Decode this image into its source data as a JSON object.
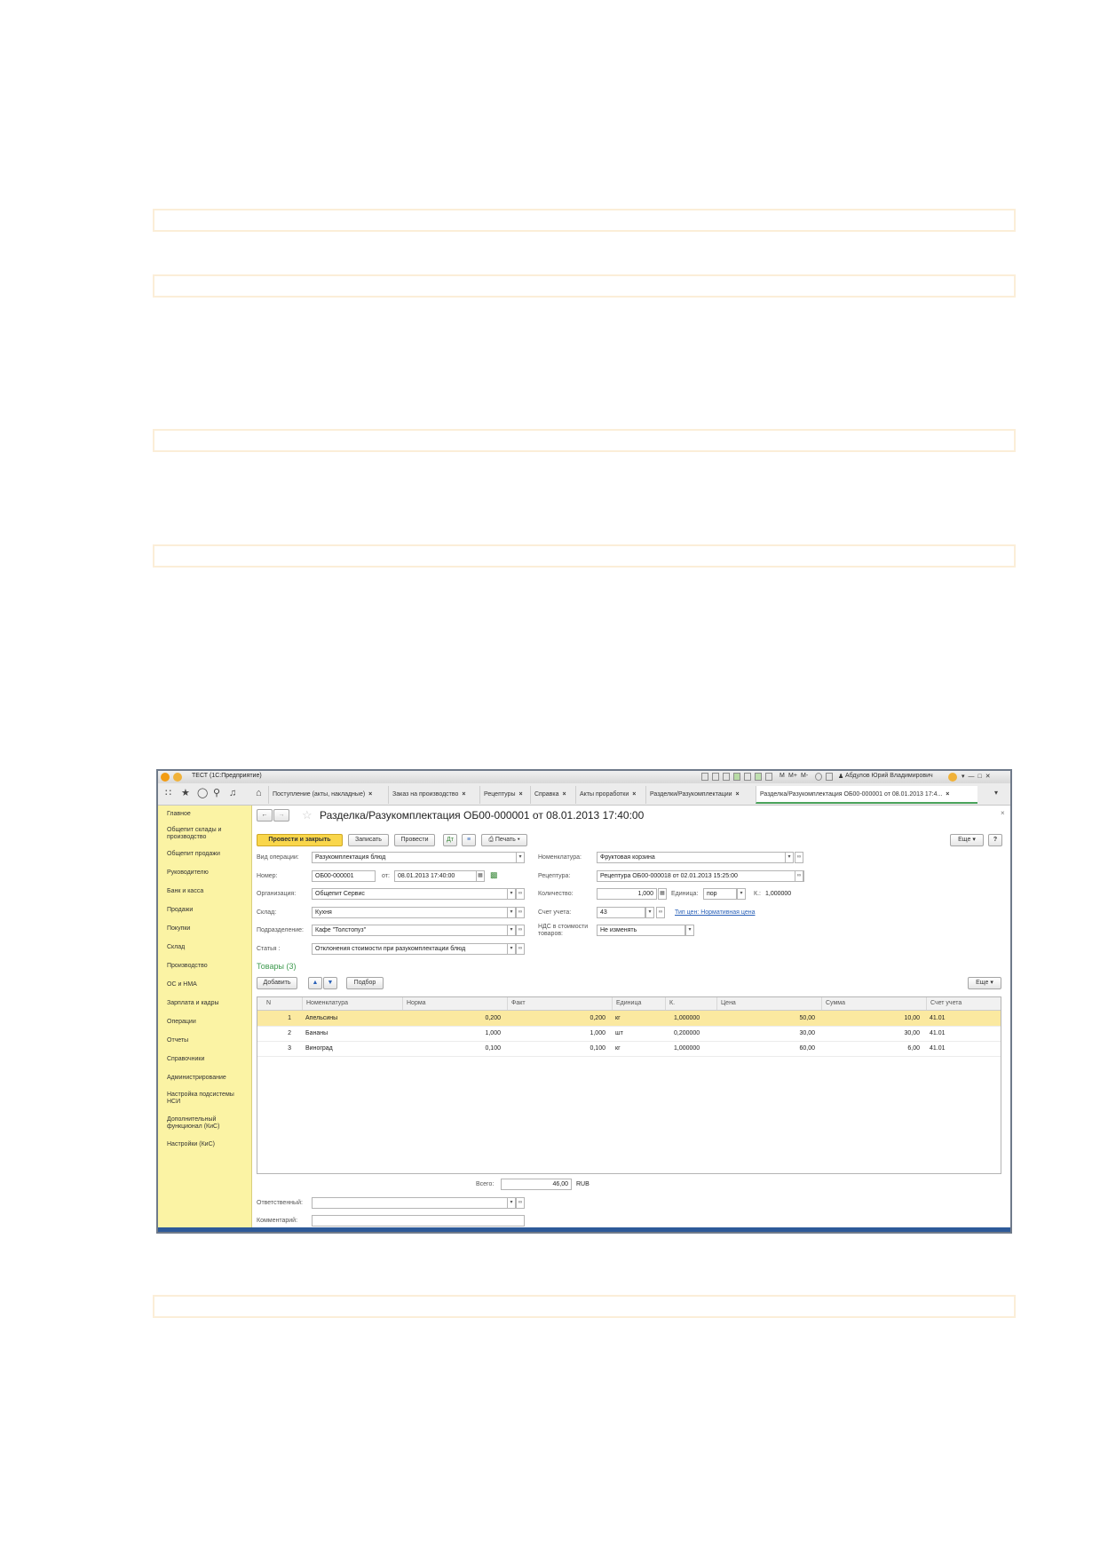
{
  "window": {
    "title": "ТЕСТ  (1С:Предприятие)",
    "user": "Абдулов Юрий Владимирович",
    "memory_buttons": [
      "M",
      "M+",
      "M-"
    ]
  },
  "tabs": [
    {
      "label": "Поступление (акты, накладные)"
    },
    {
      "label": "Заказ на производство"
    },
    {
      "label": "Рецептуры"
    },
    {
      "label": "Справка"
    },
    {
      "label": "Акты проработки"
    },
    {
      "label": "Разделки/Разукомплектации"
    },
    {
      "label": "Разделка/Разукомплектация ОБ00-000001 от 08.01.2013 17:4..."
    }
  ],
  "sidebar": [
    "Главное",
    "Общепит склады и производство",
    "Общепит продажи",
    "Руководителю",
    "Банк и касса",
    "Продажи",
    "Покупки",
    "Склад",
    "Производство",
    "ОС и НМА",
    "Зарплата и кадры",
    "Операции",
    "Отчеты",
    "Справочники",
    "Администрирование",
    "Настройка подсистемы НСИ",
    "Дополнительный функционал (КиС)",
    "Настройки (КиС)"
  ],
  "document": {
    "title": "Разделка/Разукомплектация ОБ00-000001 от 08.01.2013 17:40:00",
    "toolbar": {
      "post_close": "Провести и закрыть",
      "save": "Записать",
      "post": "Провести",
      "print": "Печать",
      "more": "Еще",
      "help": "?"
    },
    "fields": {
      "op_type_label": "Вид операции:",
      "op_type": "Разукомплектация блюд",
      "number_label": "Номер:",
      "number": "ОБ00-000001",
      "from_label": "от:",
      "date": "08.01.2013 17:40:00",
      "org_label": "Организация:",
      "org": "Общепит Сервис",
      "warehouse_label": "Склад:",
      "warehouse": "Кухня",
      "dept_label": "Подразделение:",
      "dept": "Кафе \"Толстопуз\"",
      "article_label": "Статья :",
      "article": "Отклонения стоимости при разукомплектации блюд",
      "nomen_label": "Номенклатура:",
      "nomen": "Фруктовая корзина",
      "recipe_label": "Рецептура:",
      "recipe": "Рецептура ОБ00-000018 от 02.01.2013 15:25:00",
      "qty_label": "Количество:",
      "qty": "1,000",
      "unit_label": "Единица:",
      "unit": "пор",
      "k_label": "К.:",
      "k": "1,000000",
      "account_label": "Счет учета:",
      "account": "43",
      "price_type_link": "Тип цен: Нормативная цена",
      "vat_label": "НДС в стоимости товаров:",
      "vat": "Не изменять"
    },
    "goods": {
      "title": "Товары (3)",
      "add": "Добавить",
      "pick": "Подбор",
      "more": "Еще",
      "columns": [
        "N",
        "Номенклатура",
        "Норма",
        "Факт",
        "Единица",
        "К.",
        "Цена",
        "Сумма",
        "Счет учета"
      ],
      "rows": [
        {
          "n": "1",
          "name": "Апельсины",
          "norm": "0,200",
          "fact": "0,200",
          "unit": "кг",
          "k": "1,000000",
          "price": "50,00",
          "sum": "10,00",
          "account": "41.01"
        },
        {
          "n": "2",
          "name": "Бананы",
          "norm": "1,000",
          "fact": "1,000",
          "unit": "шт",
          "k": "0,200000",
          "price": "30,00",
          "sum": "30,00",
          "account": "41.01"
        },
        {
          "n": "3",
          "name": "Виноград",
          "norm": "0,100",
          "fact": "0,100",
          "unit": "кг",
          "k": "1,000000",
          "price": "60,00",
          "sum": "6,00",
          "account": "41.01"
        }
      ]
    },
    "total_label": "Всего:",
    "total": "46,00",
    "currency": "RUB",
    "responsible_label": "Ответственный:",
    "comment_label": "Комментарий:"
  },
  "colors": {
    "sidebar": "#fbf3a4",
    "primary_button": "#f9d64b",
    "selected_row": "#fbe9a0",
    "link": "#2a61b8"
  }
}
